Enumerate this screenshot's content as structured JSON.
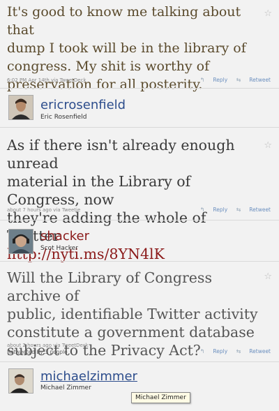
{
  "colors": {
    "screen_name": "#2d4d8c",
    "link": "#8b1a1a",
    "meta": "#888888",
    "actions": "#6b8fbf"
  },
  "tweet1": {
    "text_lines": [
      "It's good to know me talking about that",
      "dump I took will be in the library of",
      "congress. My shit is worthy of",
      "preservation for all posterity."
    ],
    "meta": "6:02 PM Apr 14th via TweetDeck",
    "reply": "Reply",
    "retweet": "Retweet"
  },
  "author1": {
    "screen_name": "ericrosenfield",
    "full_name": "Eric Rosenfield"
  },
  "tweet2": {
    "text_lines": [
      "As if there isn't already enough unread",
      "material in the Library of Congress, now",
      "they're adding the whole of Twitter"
    ],
    "link": "http://nyti.ms/8YN4lK",
    "meta": "about 7 hours ago via Tweetie",
    "reply": "Reply",
    "retweet": "Retweet"
  },
  "author2": {
    "screen_name": "shacker",
    "full_name": "Scot Hacker"
  },
  "tweet3": {
    "text_lines": [
      "Will the Library of Congress archive of",
      "public, identifiable Twitter activity",
      "constitute a government database",
      "subject to the Privacy Act?"
    ],
    "meta": "about 2 hours ago via TweetDeck",
    "retweeted_by": "Retweeted by 3 people",
    "reply": "Reply",
    "retweet": "Retweet"
  },
  "author3": {
    "screen_name": "michaelzimmer",
    "full_name": "Michael Zimmer"
  },
  "tooltip": "Michael Zimmer",
  "icons": {
    "star": "☆",
    "reply": "↰",
    "retweet": "⇆"
  }
}
